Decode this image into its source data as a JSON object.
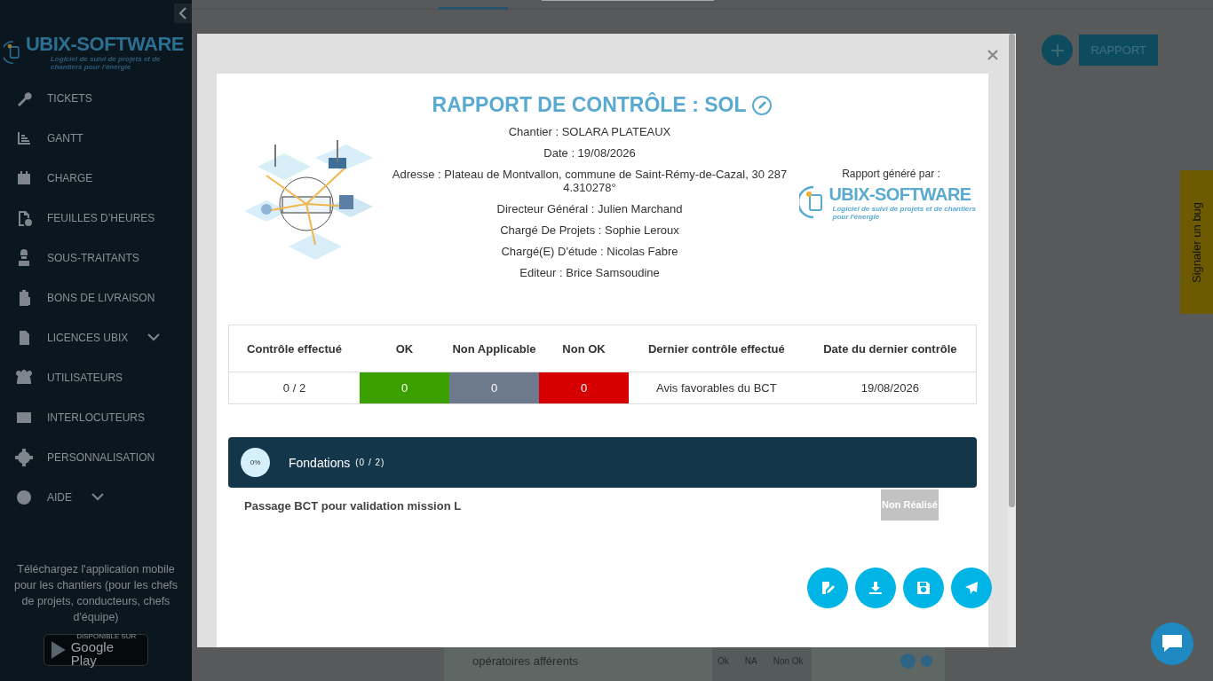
{
  "sidebar": {
    "logo": {
      "name": "UBIX-SOFTWARE",
      "tagline": "Logiciel de suivi de projets et de chantiers pour l'énergie"
    },
    "items": [
      {
        "label": "TICKETS",
        "expandable": false
      },
      {
        "label": "GANTT",
        "expandable": false
      },
      {
        "label": "CHARGE",
        "expandable": false
      },
      {
        "label": "FEUILLES D’HEURES",
        "expandable": false
      },
      {
        "label": "SOUS-TRAITANTS",
        "expandable": false
      },
      {
        "label": "BONS DE LIVRAISON",
        "expandable": false
      },
      {
        "label": "LICENCES UBIX",
        "expandable": true
      },
      {
        "label": "UTILISATEURS",
        "expandable": false
      },
      {
        "label": "INTERLOCUTEURS",
        "expandable": false
      },
      {
        "label": "PERSONNALISATION",
        "expandable": false
      },
      {
        "label": "AIDE",
        "expandable": true
      }
    ],
    "mobile_note": "Téléchargez l'application mobile pour les chantiers (pour les chefs de projets, conducteurs, chefs d'équipe)",
    "store_badge": {
      "small": "DISPONIBLE SUR",
      "name": "Google Play"
    }
  },
  "toolbar": {
    "report_button": "RAPPORT"
  },
  "background_row": {
    "text": "opératoires afférents",
    "options": [
      "Ok",
      "NA",
      "Non Ok"
    ]
  },
  "bug_tab": "Signaler un bug",
  "modal": {
    "title": "RAPPORT DE CONTRÔLE : SOL",
    "fields": [
      "Chantier : SOLARA PLATEAUX",
      "Date : 19/08/2026",
      "Adresse : Plateau de Montvallon, commune de Saint-Rémy-de-Cazal, 30 287 4.310278°",
      "Directeur Général : Julien Marchand",
      "Chargé De Projets : Sophie Leroux",
      "Chargé(E) D'étude : Nicolas Fabre",
      "Editeur : Brice Samsoudine"
    ],
    "generated_by": "Rapport généré par :",
    "brand": {
      "name": "UBIX-SOFTWARE",
      "tagline": "Logiciel de suivi de projets et de chantiers pour l'énergie"
    },
    "summary": {
      "columns": [
        "Contrôle effectué",
        "OK",
        "Non Applicable",
        "Non OK",
        "Dernier contrôle effectué",
        "Date du dernier contrôle"
      ],
      "cells": [
        {
          "text": "0 / 2"
        },
        {
          "text": "0",
          "color": "#3ca100"
        },
        {
          "text": "0",
          "color": "#6d7a8e"
        },
        {
          "text": "0",
          "color": "#d60000"
        },
        {
          "text": "Avis favorables du BCT"
        },
        {
          "text": "19/08/2026"
        }
      ]
    },
    "section": {
      "progress": "0%",
      "title": "Fondations",
      "count": "(0 / 2)",
      "items": [
        {
          "label": "Passage BCT pour validation mission L",
          "status": "Non Réalisé"
        }
      ]
    }
  }
}
